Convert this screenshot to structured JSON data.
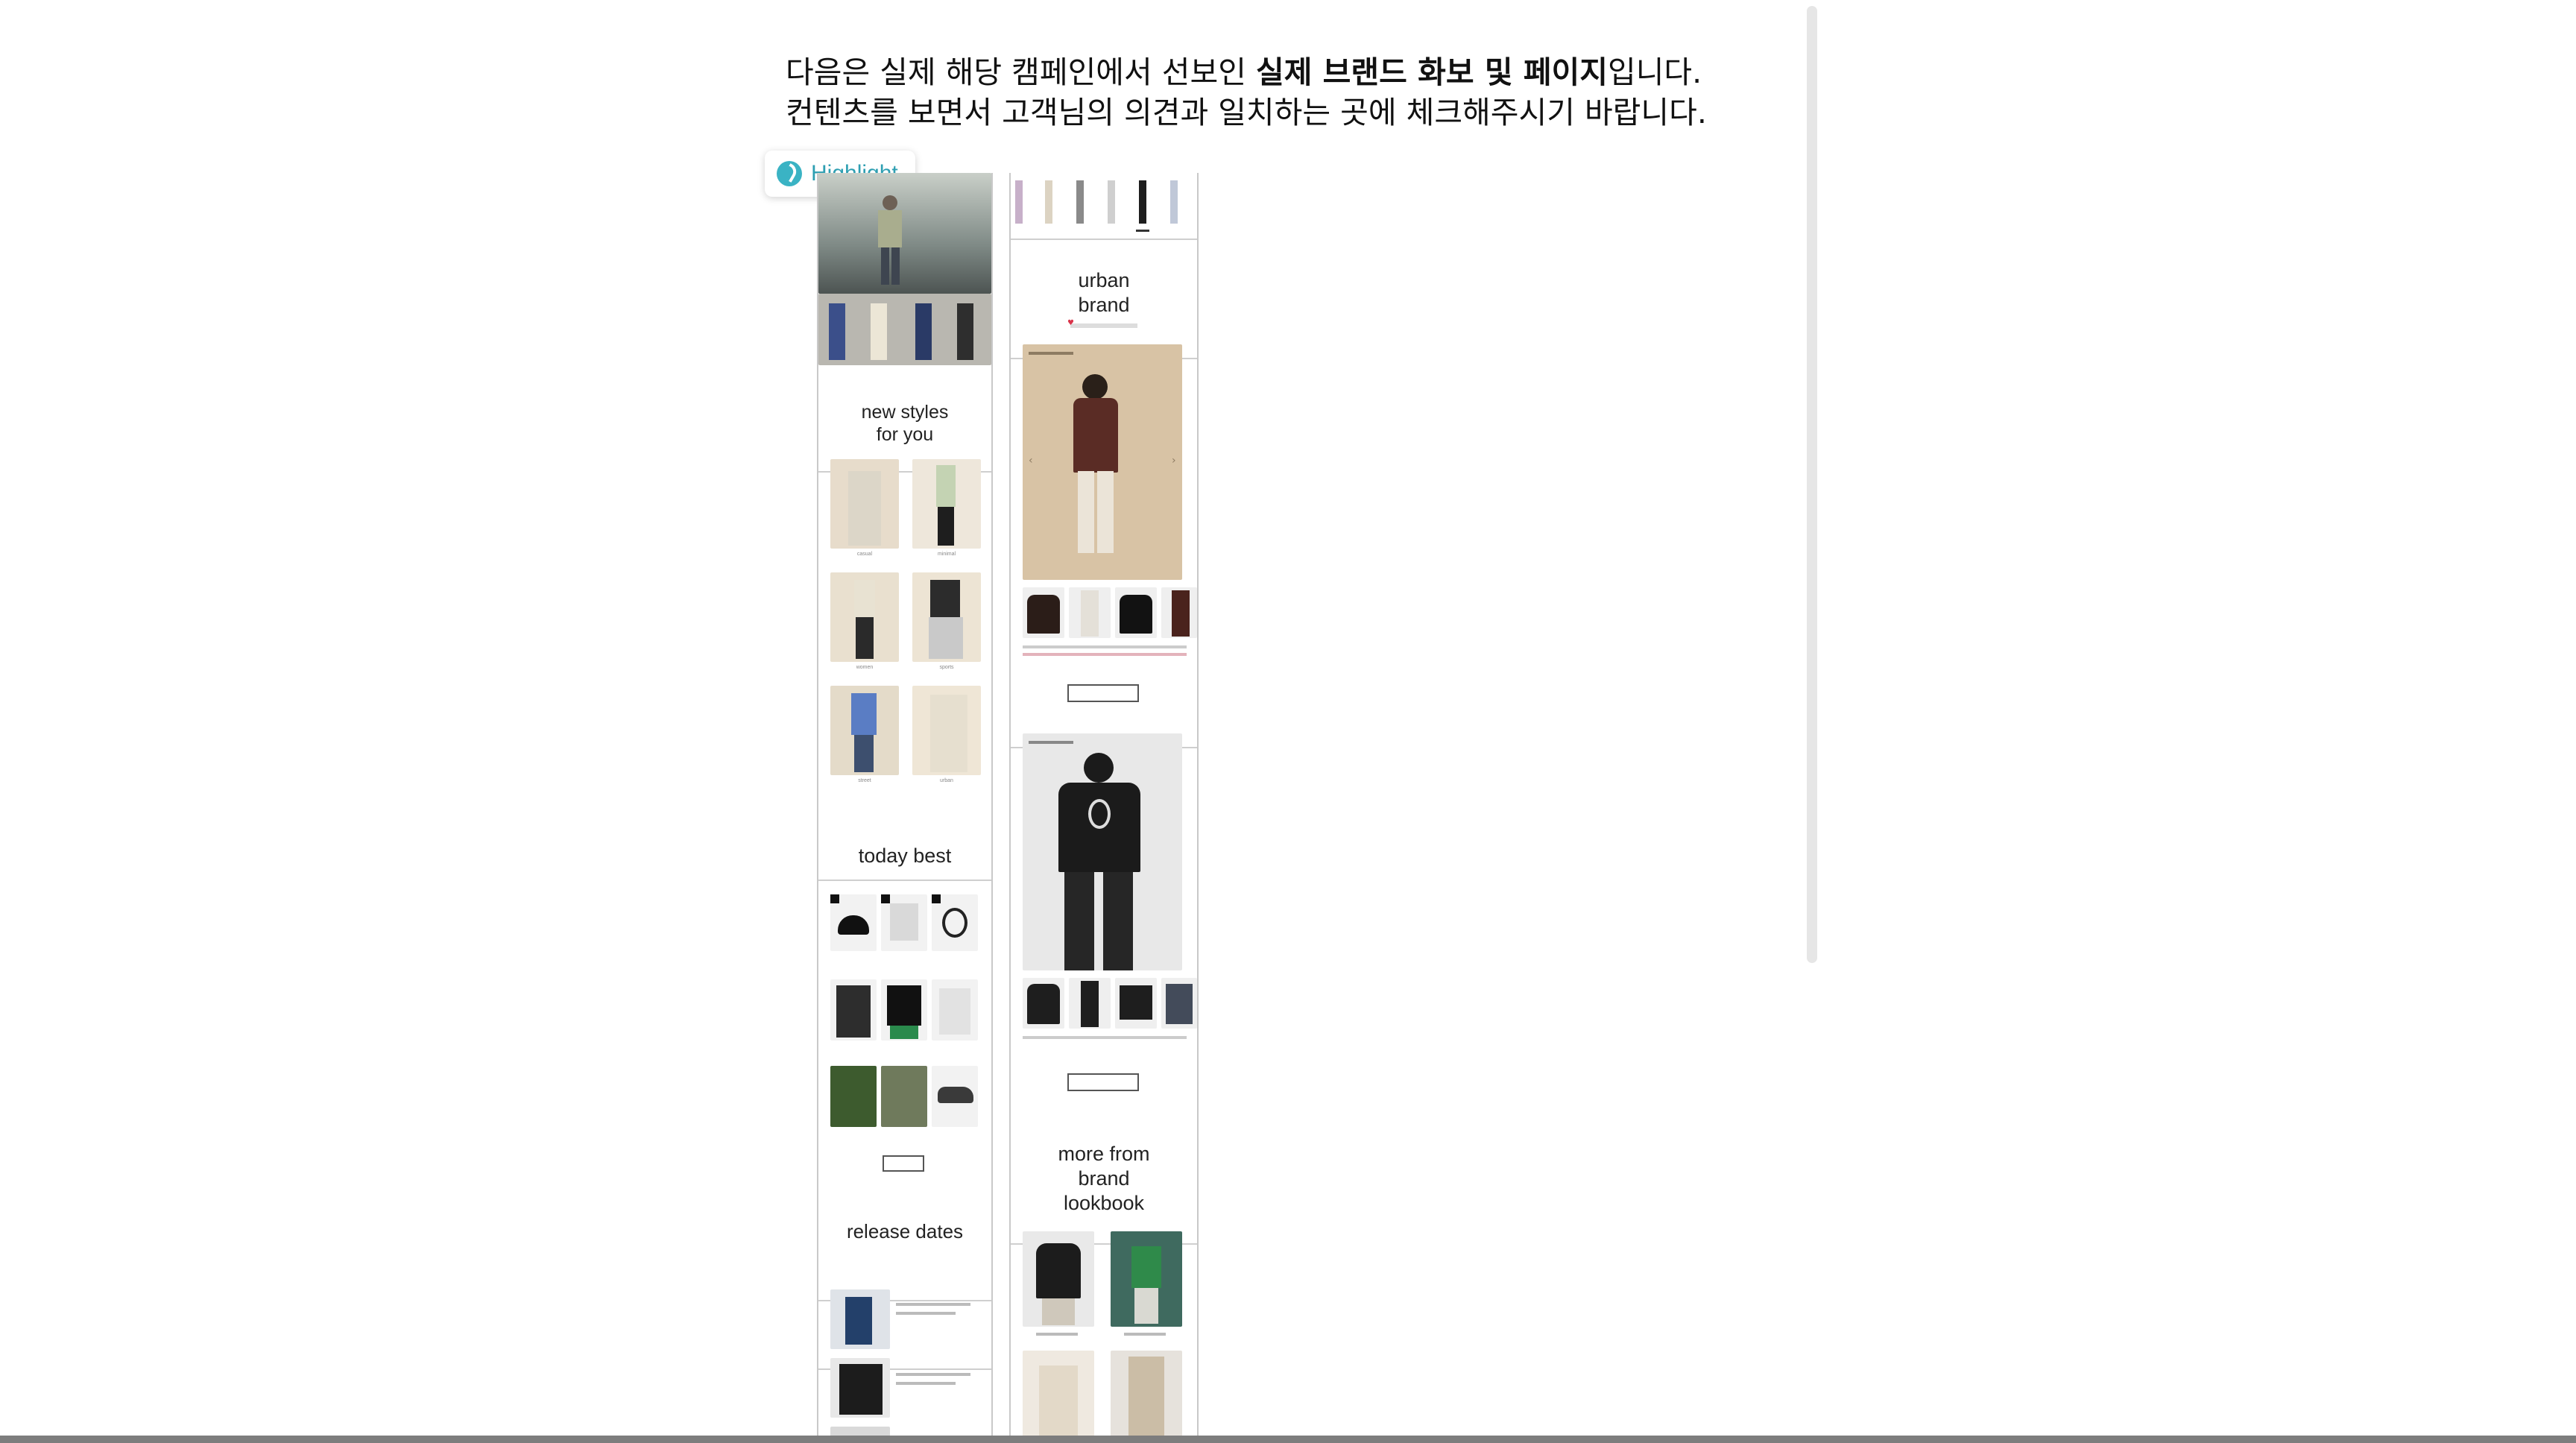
{
  "instructions": {
    "line1_pre": "다음은 실제 해당 캠페인에서 선보인 ",
    "line1_bold": "실제 브랜드 화보 및 페이지",
    "line1_post": "입니다.",
    "line2": "컨텐츠를 보면서 고객님의 의견과 일치하는 곳에 체크해주시기 바랍니다."
  },
  "highlight": {
    "label": "Highlight",
    "icon": "highlight-swirl-icon"
  },
  "left_column": {
    "new_styles_heading": "new styles\nfor you",
    "style_labels": [
      "casual",
      "minimal",
      "women",
      "sports",
      "street",
      "urban"
    ],
    "today_best_heading": "today best",
    "release_heading": "release dates"
  },
  "right_column": {
    "urban_heading": "urban\nbrand",
    "more_heading": "more from\nbrand\nlookbook"
  },
  "colors": {
    "accent": "#3ab3c4",
    "brand_red": "#d9344a",
    "frame_border": "#c9c9c9",
    "photo_beige": "#d8c3a5",
    "photo_blue": "#5a7dc4",
    "dark_garment": "#1b1b1b"
  }
}
